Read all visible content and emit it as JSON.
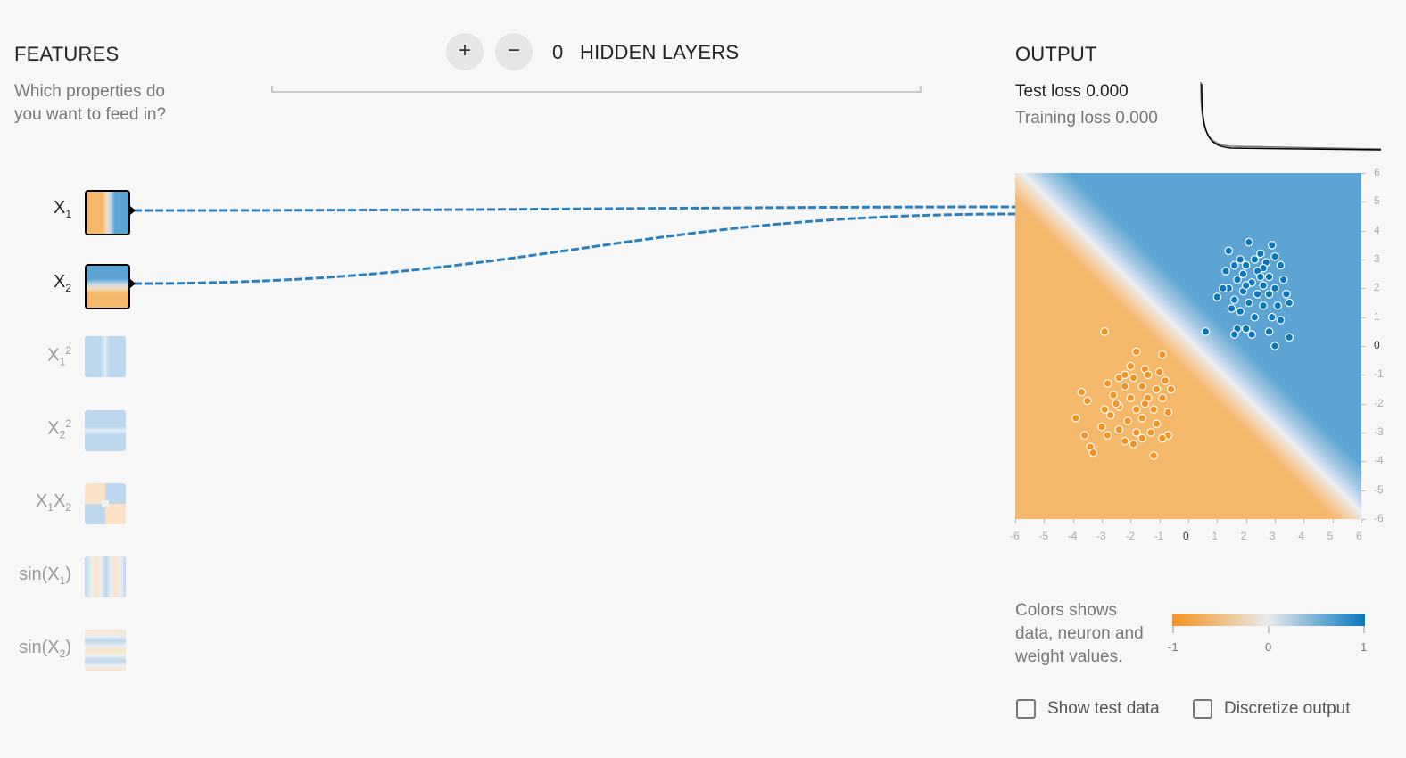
{
  "features": {
    "title": "FEATURES",
    "subtitle_line1": "Which properties do",
    "subtitle_line2": "you want to feed in?",
    "items": [
      {
        "base": "X",
        "sub": "1",
        "sup": "",
        "prefix": "",
        "suffix": "",
        "active": true
      },
      {
        "base": "X",
        "sub": "2",
        "sup": "",
        "prefix": "",
        "suffix": "",
        "active": true
      },
      {
        "base": "X",
        "sub": "1",
        "sup": "2",
        "prefix": "",
        "suffix": "",
        "active": false
      },
      {
        "base": "X",
        "sub": "2",
        "sup": "2",
        "prefix": "",
        "suffix": "",
        "active": false
      },
      {
        "base": "X",
        "sub": "1",
        "sup": "",
        "base2": "X",
        "sub2": "2",
        "prefix": "",
        "suffix": "",
        "active": false
      },
      {
        "base": "X",
        "sub": "1",
        "sup": "",
        "prefix": "sin(",
        "suffix": ")",
        "active": false
      },
      {
        "base": "X",
        "sub": "2",
        "sup": "",
        "prefix": "sin(",
        "suffix": ")",
        "active": false
      }
    ]
  },
  "layers": {
    "add_label": "+",
    "remove_label": "−",
    "count": "0",
    "label": "HIDDEN LAYERS"
  },
  "output": {
    "title": "OUTPUT",
    "test_loss_label": "Test loss",
    "test_loss_value": "0.000",
    "training_loss_label": "Training loss",
    "training_loss_value": "0.000"
  },
  "colors": {
    "orange": "#f59322",
    "blue": "#0877bd",
    "light_orange": "#f5b76a",
    "light_blue": "#5ba4d3",
    "link": "#2a7fc1"
  },
  "legend": {
    "text_line1": "Colors shows",
    "text_line2": "data, neuron and",
    "text_line3": "weight values.",
    "min": "-1",
    "mid": "0",
    "max": "1"
  },
  "options": {
    "show_test_data": "Show test data",
    "discretize_output": "Discretize output",
    "show_test_data_checked": false,
    "discretize_output_checked": false
  },
  "chart_data": {
    "type": "scatter",
    "title": "",
    "xlabel": "",
    "ylabel": "",
    "xlim": [
      -6,
      6
    ],
    "ylim": [
      -6,
      6
    ],
    "x_ticks": [
      "-6",
      "-5",
      "-4",
      "-3",
      "-2",
      "-1",
      "0",
      "1",
      "2",
      "3",
      "4",
      "5",
      "6"
    ],
    "y_ticks": [
      "6",
      "5",
      "4",
      "3",
      "2",
      "1",
      "0",
      "-1",
      "-2",
      "-3",
      "-4",
      "-5",
      "-6"
    ],
    "decision_boundary": "x + y = 0",
    "series": [
      {
        "class": "positive",
        "color": "#0877bd",
        "points": [
          [
            2.1,
            3.6
          ],
          [
            2.9,
            3.5
          ],
          [
            1.4,
            3.3
          ],
          [
            2.5,
            3.2
          ],
          [
            3.0,
            3.1
          ],
          [
            1.8,
            3.0
          ],
          [
            2.3,
            3.0
          ],
          [
            2.7,
            2.9
          ],
          [
            1.6,
            2.8
          ],
          [
            2.0,
            2.8
          ],
          [
            2.6,
            2.7
          ],
          [
            3.2,
            2.8
          ],
          [
            1.3,
            2.6
          ],
          [
            1.9,
            2.5
          ],
          [
            2.4,
            2.6
          ],
          [
            2.8,
            2.4
          ],
          [
            3.3,
            2.3
          ],
          [
            1.7,
            2.3
          ],
          [
            2.2,
            2.2
          ],
          [
            2.6,
            2.1
          ],
          [
            3.0,
            2.0
          ],
          [
            1.4,
            2.0
          ],
          [
            1.9,
            1.9
          ],
          [
            2.4,
            1.8
          ],
          [
            2.8,
            1.8
          ],
          [
            3.4,
            1.8
          ],
          [
            1.6,
            1.6
          ],
          [
            2.1,
            1.5
          ],
          [
            2.6,
            1.4
          ],
          [
            3.1,
            1.4
          ],
          [
            1.0,
            1.7
          ],
          [
            1.8,
            1.2
          ],
          [
            2.3,
            1.0
          ],
          [
            2.9,
            1.0
          ],
          [
            3.2,
            0.9
          ],
          [
            1.7,
            0.6
          ],
          [
            2.2,
            0.4
          ],
          [
            2.0,
            0.6
          ],
          [
            2.8,
            0.5
          ],
          [
            0.6,
            0.5
          ],
          [
            1.6,
            0.4
          ],
          [
            3.0,
            0.0
          ],
          [
            3.5,
            0.3
          ],
          [
            1.2,
            2.0
          ],
          [
            3.5,
            1.5
          ],
          [
            2.0,
            2.1
          ],
          [
            2.5,
            2.4
          ],
          [
            1.5,
            1.3
          ]
        ]
      },
      {
        "class": "negative",
        "color": "#f59322",
        "points": [
          [
            -2.9,
            0.5
          ],
          [
            -1.8,
            -0.2
          ],
          [
            -0.9,
            -0.3
          ],
          [
            -2.0,
            -0.7
          ],
          [
            -1.5,
            -0.8
          ],
          [
            -1.0,
            -0.9
          ],
          [
            -2.4,
            -1.1
          ],
          [
            -1.9,
            -1.1
          ],
          [
            -1.4,
            -1.0
          ],
          [
            -0.8,
            -1.2
          ],
          [
            -2.8,
            -1.3
          ],
          [
            -2.2,
            -1.4
          ],
          [
            -1.6,
            -1.4
          ],
          [
            -1.1,
            -1.5
          ],
          [
            -0.6,
            -1.5
          ],
          [
            -3.7,
            -1.6
          ],
          [
            -2.6,
            -1.7
          ],
          [
            -2.0,
            -1.8
          ],
          [
            -1.4,
            -1.8
          ],
          [
            -0.9,
            -1.8
          ],
          [
            -3.5,
            -1.9
          ],
          [
            -2.4,
            -2.1
          ],
          [
            -1.8,
            -2.2
          ],
          [
            -1.2,
            -2.2
          ],
          [
            -0.7,
            -2.3
          ],
          [
            -3.9,
            -2.5
          ],
          [
            -2.7,
            -2.4
          ],
          [
            -2.1,
            -2.6
          ],
          [
            -1.6,
            -2.5
          ],
          [
            -1.1,
            -2.7
          ],
          [
            -3.0,
            -2.8
          ],
          [
            -2.4,
            -2.9
          ],
          [
            -1.8,
            -3.0
          ],
          [
            -1.3,
            -3.0
          ],
          [
            -0.7,
            -3.1
          ],
          [
            -3.6,
            -3.1
          ],
          [
            -2.8,
            -3.1
          ],
          [
            -2.2,
            -3.3
          ],
          [
            -1.6,
            -3.2
          ],
          [
            -0.9,
            -3.2
          ],
          [
            -3.4,
            -3.5
          ],
          [
            -3.3,
            -3.7
          ],
          [
            -1.9,
            -3.4
          ],
          [
            -1.2,
            -3.8
          ],
          [
            -2.5,
            -2.0
          ],
          [
            -1.5,
            -2.0
          ],
          [
            -2.2,
            -1.0
          ],
          [
            -2.9,
            -2.2
          ]
        ]
      }
    ]
  }
}
